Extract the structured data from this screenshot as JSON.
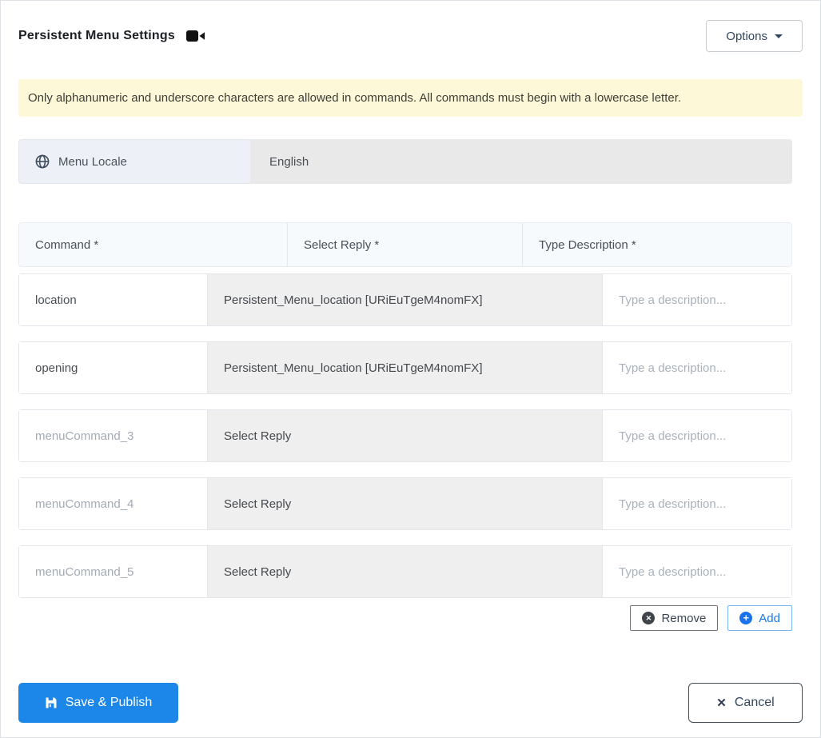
{
  "header": {
    "title": "Persistent Menu Settings",
    "options_label": "Options"
  },
  "banner": {
    "text": "Only alphanumeric and underscore characters are allowed in commands. All commands must begin with a lowercase letter."
  },
  "locale": {
    "label": "Menu Locale",
    "value": "English"
  },
  "table": {
    "headers": [
      "Command *",
      "Select Reply *",
      "Type Description *"
    ],
    "rows": [
      {
        "command": "location",
        "reply": "Persistent_Menu_location [URiEuTgeM4nomFX]",
        "description_placeholder": "Type a description..."
      },
      {
        "command": "opening",
        "reply": "Persistent_Menu_location [URiEuTgeM4nomFX]",
        "description_placeholder": "Type a description..."
      },
      {
        "command": "menuCommand_3",
        "reply": "Select Reply",
        "description_placeholder": "Type a description..."
      },
      {
        "command": "menuCommand_4",
        "reply": "Select Reply",
        "description_placeholder": "Type a description..."
      },
      {
        "command": "menuCommand_5",
        "reply": "Select Reply",
        "description_placeholder": "Type a description..."
      }
    ]
  },
  "actions": {
    "remove_label": "Remove",
    "add_label": "Add",
    "remove_icon_glyph": "✕",
    "add_icon_glyph": "+"
  },
  "footer": {
    "save_label": "Save & Publish",
    "cancel_label": "Cancel",
    "cancel_icon_glyph": "✕"
  },
  "colors": {
    "primary_blue": "#1c87e8",
    "add_blue": "#1a73e8",
    "banner_yellow": "#fdf8d8",
    "locale_left_bg": "#edf1f7",
    "locale_right_bg": "#e9e9e9",
    "select_cell_bg": "#efefef",
    "header_bg": "#f7fafc"
  }
}
